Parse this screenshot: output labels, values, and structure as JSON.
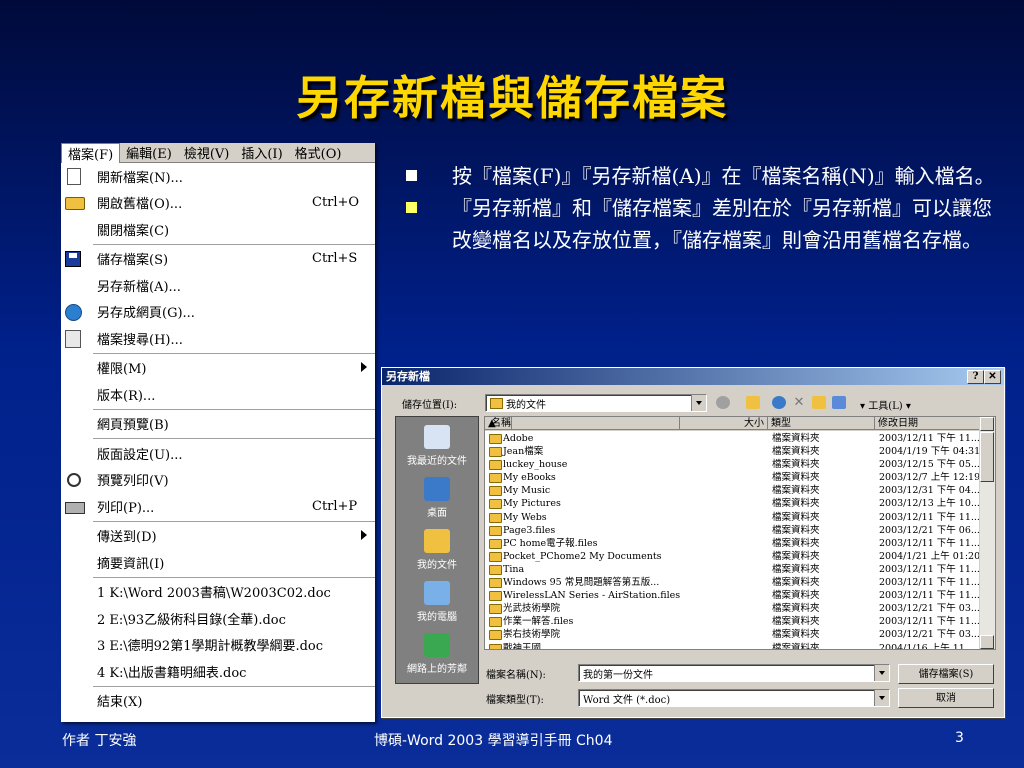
{
  "slide": {
    "title": "另存新檔與儲存檔案",
    "bullets": [
      {
        "text": "按『檔案(F)』『另存新檔(A)』在『檔案名稱(N)』輸入檔名。",
        "bullet_color": "#ffffff"
      },
      {
        "text": "『另存新檔』和『儲存檔案』差別在於『另存新檔』可以讓您改變檔名以及存放位置，『儲存檔案』則會沿用舊檔名存檔。",
        "bullet_color": "#ffff66"
      }
    ],
    "footer": {
      "author": "作者  丁安強",
      "center": "博碩-Word 2003 學習導引手冊 Ch04",
      "page": "3"
    },
    "title_color": "#ffd700"
  },
  "menu": {
    "bar": [
      "檔案(F)",
      "編輯(E)",
      "檢視(V)",
      "插入(I)",
      "格式(O)"
    ],
    "groups": [
      [
        {
          "label": "開新檔案(N)...",
          "shortcut": "",
          "icon": "new-document-icon"
        },
        {
          "label": "開啟舊檔(O)...",
          "shortcut": "Ctrl+O",
          "icon": "open-folder-icon"
        },
        {
          "label": "關閉檔案(C)",
          "shortcut": "",
          "icon": ""
        }
      ],
      [
        {
          "label": "儲存檔案(S)",
          "shortcut": "Ctrl+S",
          "icon": "save-icon"
        },
        {
          "label": "另存新檔(A)...",
          "shortcut": "",
          "icon": ""
        },
        {
          "label": "另存成網頁(G)...",
          "shortcut": "",
          "icon": "save-as-web-icon"
        },
        {
          "label": "檔案搜尋(H)...",
          "shortcut": "",
          "icon": "file-search-icon"
        }
      ],
      [
        {
          "label": "權限(M)",
          "shortcut": "",
          "icon": "",
          "submenu": true
        },
        {
          "label": "版本(R)...",
          "shortcut": "",
          "icon": ""
        }
      ],
      [
        {
          "label": "網頁預覽(B)",
          "shortcut": "",
          "icon": ""
        }
      ],
      [
        {
          "label": "版面設定(U)...",
          "shortcut": "",
          "icon": ""
        },
        {
          "label": "預覽列印(V)",
          "shortcut": "",
          "icon": "print-preview-icon"
        },
        {
          "label": "列印(P)...",
          "shortcut": "Ctrl+P",
          "icon": "print-icon"
        }
      ],
      [
        {
          "label": "傳送到(D)",
          "shortcut": "",
          "icon": "",
          "submenu": true
        },
        {
          "label": "摘要資訊(I)",
          "shortcut": "",
          "icon": ""
        }
      ],
      [
        {
          "label": "1 K:\\Word 2003書稿\\W2003C02.doc",
          "shortcut": "",
          "icon": ""
        },
        {
          "label": "2 E:\\93乙級術科目錄(全華).doc",
          "shortcut": "",
          "icon": ""
        },
        {
          "label": "3 E:\\德明92第1學期計概教學綱要.doc",
          "shortcut": "",
          "icon": ""
        },
        {
          "label": "4 K:\\出版書籍明細表.doc",
          "shortcut": "",
          "icon": ""
        }
      ],
      [
        {
          "label": "結束(X)",
          "shortcut": "",
          "icon": ""
        }
      ]
    ]
  },
  "dialog": {
    "title": "另存新檔",
    "title_buttons": {
      "help": "?",
      "close": "✕"
    },
    "save_in_label": "儲存位置(I):",
    "save_in_value": "我的文件",
    "tools_label": "工具(L)",
    "places": [
      "我最近的文件",
      "桌面",
      "我的文件",
      "我的電腦",
      "網路上的芳鄰"
    ],
    "columns": {
      "name": "名稱",
      "size": "大小",
      "type": "類型",
      "modified": "修改日期"
    },
    "files": [
      {
        "name": "Adobe",
        "type": "檔案資料夾",
        "date": "2003/12/11 下午 11..."
      },
      {
        "name": "Jean檔案",
        "type": "檔案資料夾",
        "date": "2004/1/19 下午 04:31"
      },
      {
        "name": "luckey_house",
        "type": "檔案資料夾",
        "date": "2003/12/15 下午 05..."
      },
      {
        "name": "My eBooks",
        "type": "檔案資料夾",
        "date": "2003/12/7 上午 12:19"
      },
      {
        "name": "My Music",
        "type": "檔案資料夾",
        "date": "2003/12/31 下午 04..."
      },
      {
        "name": "My Pictures",
        "type": "檔案資料夾",
        "date": "2003/12/13 上午 10..."
      },
      {
        "name": "My Webs",
        "type": "檔案資料夾",
        "date": "2003/12/11 下午 11..."
      },
      {
        "name": "Page3.files",
        "type": "檔案資料夾",
        "date": "2003/12/21 下午 06..."
      },
      {
        "name": "PC home電子報.files",
        "type": "檔案資料夾",
        "date": "2003/12/11 下午 11..."
      },
      {
        "name": "Pocket_PChome2 My Documents",
        "type": "檔案資料夾",
        "date": "2004/1/21 上午 01:20"
      },
      {
        "name": "Tina",
        "type": "檔案資料夾",
        "date": "2003/12/11 下午 11..."
      },
      {
        "name": "Windows 95 常見問題解答第五版...",
        "type": "檔案資料夾",
        "date": "2003/12/11 下午 11..."
      },
      {
        "name": "WirelessLAN Series - AirStation.files",
        "type": "檔案資料夾",
        "date": "2003/12/11 下午 11..."
      },
      {
        "name": "光武技術學院",
        "type": "檔案資料夾",
        "date": "2003/12/21 下午 03..."
      },
      {
        "name": "作業一解答.files",
        "type": "檔案資料夾",
        "date": "2003/12/11 下午 11..."
      },
      {
        "name": "崇右技術學院",
        "type": "檔案資料夾",
        "date": "2003/12/21 下午 03..."
      },
      {
        "name": "戰神王國",
        "type": "檔案資料夾",
        "date": "2004/1/16 上午 11..."
      }
    ],
    "filename_label": "檔案名稱(N):",
    "filename_value": "我的第一份文件",
    "filetype_label": "檔案類型(T):",
    "filetype_value": "Word 文件 (*.doc)",
    "save_button": "儲存檔案(S)",
    "cancel_button": "取消"
  }
}
